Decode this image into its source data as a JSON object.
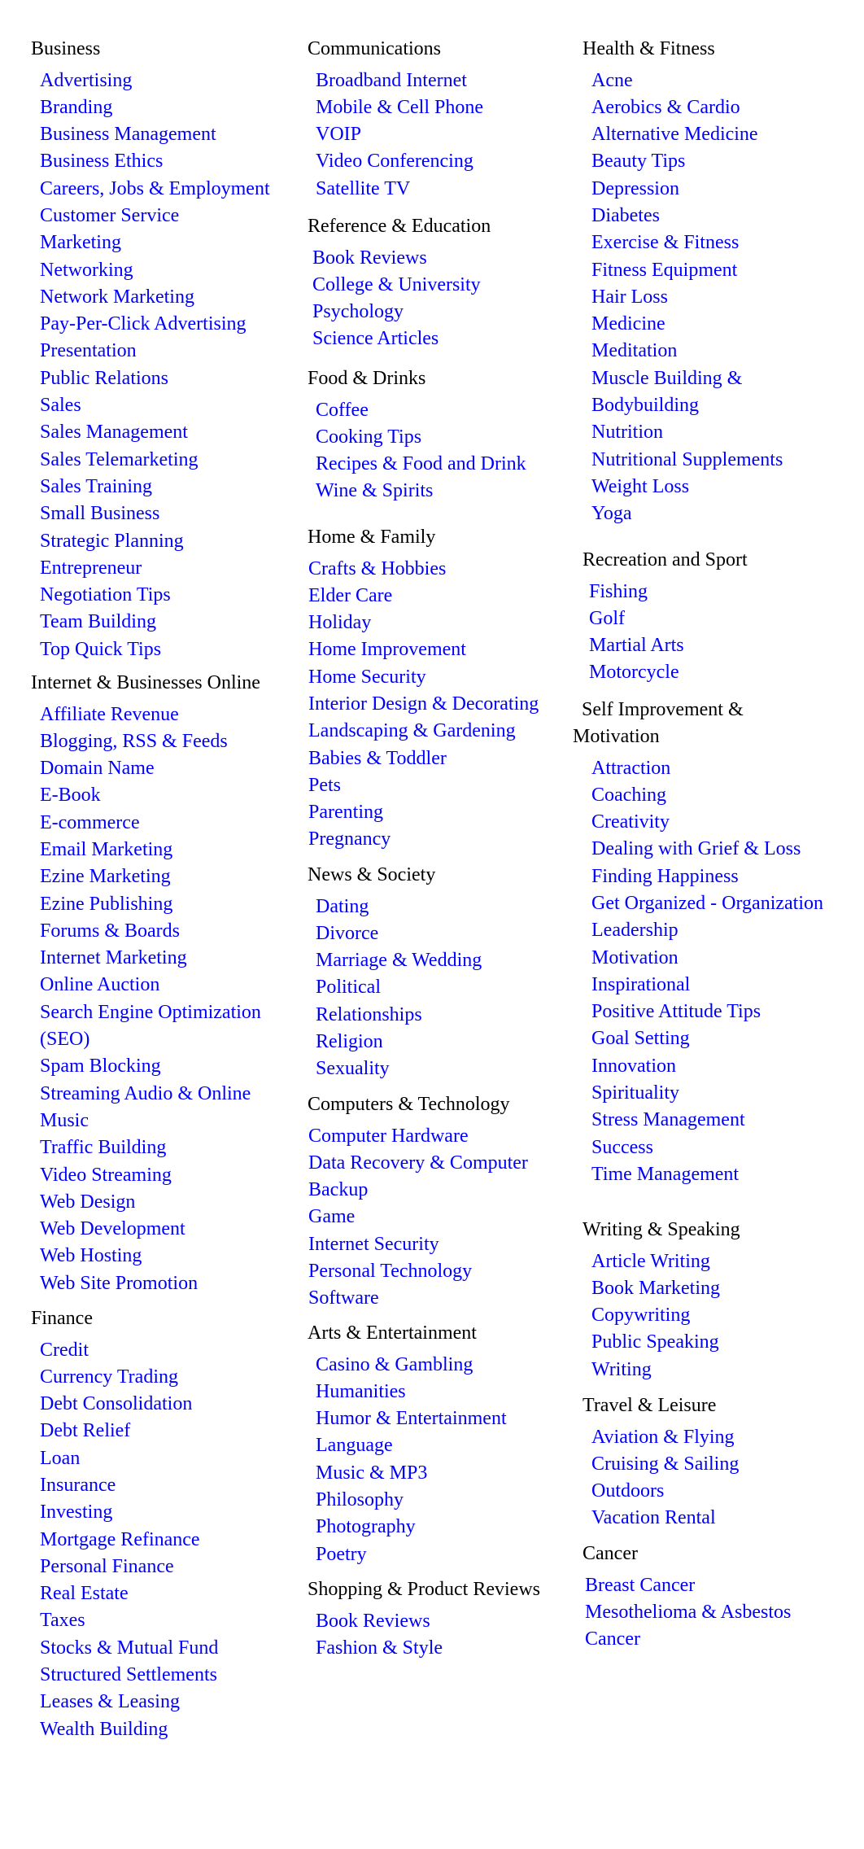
{
  "colors": {
    "link": "#0000ff",
    "heading": "#000000",
    "background": "#ffffff"
  },
  "columns": [
    {
      "sections": [
        {
          "title": "Business",
          "items": [
            "Advertising",
            "Branding",
            "Business Management",
            "Business Ethics",
            "Careers, Jobs & Employment",
            "Customer Service",
            "Marketing",
            "Networking",
            "Network Marketing",
            "Pay-Per-Click Advertising",
            "Presentation",
            "Public Relations",
            "Sales",
            "Sales Management",
            "Sales Telemarketing",
            "Sales Training",
            "Small Business",
            "Strategic Planning",
            "Entrepreneur",
            "Negotiation Tips",
            "Team Building",
            "Top Quick Tips"
          ]
        },
        {
          "title": "Internet & Businesses Online",
          "items": [
            "Affiliate Revenue",
            "Blogging, RSS & Feeds",
            "Domain Name",
            "E-Book",
            "E-commerce",
            "Email Marketing",
            "Ezine Marketing",
            "Ezine Publishing",
            "Forums & Boards",
            "Internet Marketing",
            "Online Auction",
            "Search Engine Optimization (SEO)",
            "Spam Blocking",
            "Streaming Audio & Online Music",
            "Traffic Building",
            "Video Streaming",
            "Web Design",
            "Web Development",
            "Web Hosting",
            "Web Site Promotion"
          ]
        },
        {
          "title": "Finance",
          "items": [
            "Credit",
            "Currency Trading",
            "Debt Consolidation",
            "Debt Relief",
            "Loan",
            "Insurance",
            "Investing",
            "Mortgage Refinance",
            "Personal Finance",
            "Real Estate",
            "Taxes",
            "Stocks & Mutual Fund",
            "Structured Settlements",
            "Leases & Leasing",
            "Wealth Building"
          ]
        }
      ]
    },
    {
      "sections": [
        {
          "title": "Communications",
          "items": [
            "Broadband Internet",
            "Mobile & Cell Phone",
            "VOIP",
            "Video Conferencing",
            "Satellite TV"
          ]
        },
        {
          "title": "Reference & Education",
          "items": [
            "Book Reviews",
            "College & University",
            "Psychology",
            "Science Articles"
          ]
        },
        {
          "title": "Food & Drinks",
          "items": [
            "Coffee",
            "Cooking Tips",
            "Recipes & Food and Drink",
            "Wine & Spirits"
          ]
        },
        {
          "title": "Home & Family",
          "items": [
            "Crafts & Hobbies",
            "Elder Care",
            "Holiday",
            "Home Improvement",
            "Home Security",
            "Interior Design & Decorating",
            "Landscaping & Gardening",
            "Babies & Toddler",
            "Pets",
            "Parenting",
            "Pregnancy"
          ]
        },
        {
          "title": "News & Society",
          "items": [
            "Dating",
            "Divorce",
            "Marriage & Wedding",
            "Political",
            "Relationships",
            "Religion",
            "Sexuality"
          ]
        },
        {
          "title": "Computers & Technology",
          "items": [
            "Computer Hardware",
            "Data Recovery & Computer Backup",
            "Game",
            "Internet Security",
            "Personal Technology",
            "Software"
          ]
        },
        {
          "title": "Arts & Entertainment",
          "items": [
            "Casino & Gambling",
            "Humanities",
            "Humor & Entertainment",
            "Language",
            "Music & MP3",
            "Philosophy",
            "Photography",
            "Poetry"
          ]
        },
        {
          "title": "Shopping & Product Reviews",
          "items": [
            "Book Reviews",
            "Fashion & Style"
          ]
        }
      ]
    },
    {
      "sections": [
        {
          "title": "Health & Fitness",
          "items": [
            "Acne",
            "Aerobics & Cardio",
            "Alternative Medicine",
            "Beauty Tips",
            "Depression",
            "Diabetes",
            "Exercise & Fitness",
            "Fitness Equipment",
            "Hair Loss",
            "Medicine",
            "Meditation",
            "Muscle Building & Bodybuilding",
            "Nutrition",
            "Nutritional Supplements",
            "Weight Loss",
            "Yoga"
          ]
        },
        {
          "title": "Recreation and Sport",
          "items": [
            "Fishing",
            "Golf",
            "Martial Arts",
            "Motorcycle"
          ]
        },
        {
          "title": "Self Improvement & Motivation",
          "items": [
            "Attraction",
            "Coaching",
            "Creativity",
            "Dealing with Grief & Loss",
            "Finding Happiness",
            "Get Organized - Organization",
            "Leadership",
            "Motivation",
            "Inspirational",
            "Positive Attitude Tips",
            "Goal Setting",
            "Innovation",
            "Spirituality",
            "Stress Management",
            "Success",
            "Time Management"
          ]
        },
        {
          "title": "Writing & Speaking",
          "items": [
            "Article Writing",
            "Book Marketing",
            "Copywriting",
            "Public Speaking",
            "Writing"
          ]
        },
        {
          "title": "Travel & Leisure",
          "items": [
            "Aviation & Flying",
            "Cruising & Sailing",
            "Outdoors",
            "Vacation Rental"
          ]
        },
        {
          "title": "Cancer",
          "items": [
            "Breast Cancer",
            "Mesothelioma & Asbestos",
            "Cancer"
          ]
        }
      ]
    }
  ]
}
